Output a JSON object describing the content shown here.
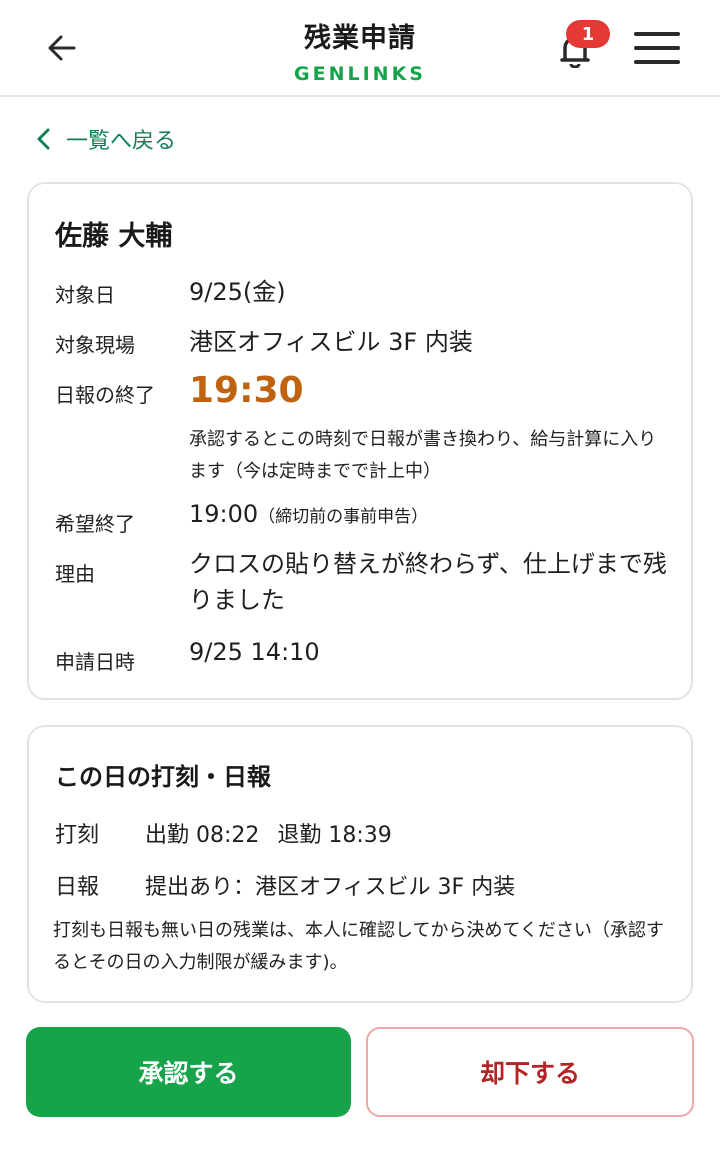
{
  "header": {
    "title": "残業申請",
    "brand": "GENLINKS",
    "notification_count": "1"
  },
  "nav": {
    "back_link": "一覧へ戻る"
  },
  "request": {
    "name": "佐藤 大輔",
    "fields": {
      "target_date_label": "対象日",
      "target_date": "9/25(金)",
      "site_label": "対象現場",
      "site": "港区オフィスビル 3F 内装",
      "report_end_label": "日報の終了",
      "report_end": "19:30",
      "report_end_note": "承認するとこの時刻で日報が書き換わり、給与計算に入ります（今は定時までで計上中）",
      "desired_end_label": "希望終了",
      "desired_end": "19:00",
      "desired_end_note": "（締切前の事前申告）",
      "reason_label": "理由",
      "reason": "クロスの貼り替えが終わらず、仕上げまで残りました",
      "submitted_label": "申請日時",
      "submitted": "9/25 14:10"
    }
  },
  "day_record": {
    "title": "この日の打刻・日報",
    "punch_label": "打刻",
    "clock_in": "出勤 08:22",
    "clock_out": "退勤 18:39",
    "report_label": "日報",
    "report_value": "提出あり：港区オフィスビル 3F 内装",
    "note": "打刻も日報も無い日の残業は、本人に確認してから決めてください（承認するとその日の入力制限が緩みます)。"
  },
  "actions": {
    "approve": "承認する",
    "reject": "却下する"
  },
  "colors": {
    "brand_green": "#16a34a",
    "link_green": "#128055",
    "highlight_orange": "#c0620f",
    "badge_red": "#e53935",
    "reject_red": "#b32525"
  }
}
